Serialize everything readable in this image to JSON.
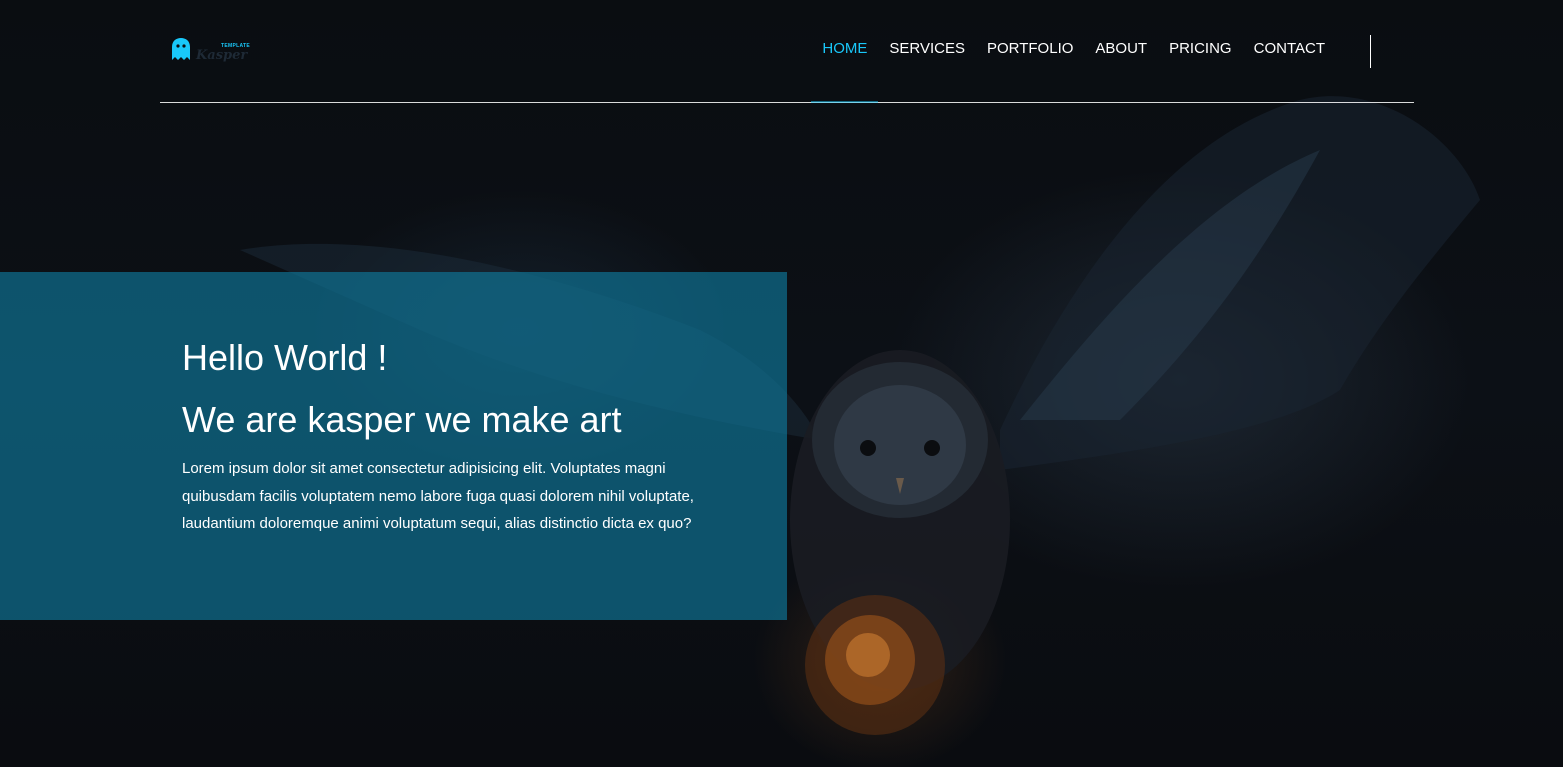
{
  "brand": {
    "small_text": "TEMPLATE",
    "name": "Kasper",
    "logo_icon": "ghost-icon",
    "accent_color": "#19c8fa"
  },
  "nav": {
    "items": [
      {
        "label": "HOME",
        "active": true
      },
      {
        "label": "SERVICES",
        "active": false
      },
      {
        "label": "PORTFOLIO",
        "active": false
      },
      {
        "label": "ABOUT",
        "active": false
      },
      {
        "label": "PRICING",
        "active": false
      },
      {
        "label": "CONTACT",
        "active": false
      }
    ]
  },
  "landing": {
    "title_line_1": "Hello World !",
    "title_line_2": "We are kasper we make art",
    "description": "Lorem ipsum dolor sit amet consectetur adipisicing elit. Voluptates magni quibusdam facilis voluptatem nemo labore fuga quasi dolorem nihil voluptate, laudantium doloremque animi voluptatum sequi, alias distinctio dicta ex quo?",
    "box_color": "#0f7496"
  }
}
